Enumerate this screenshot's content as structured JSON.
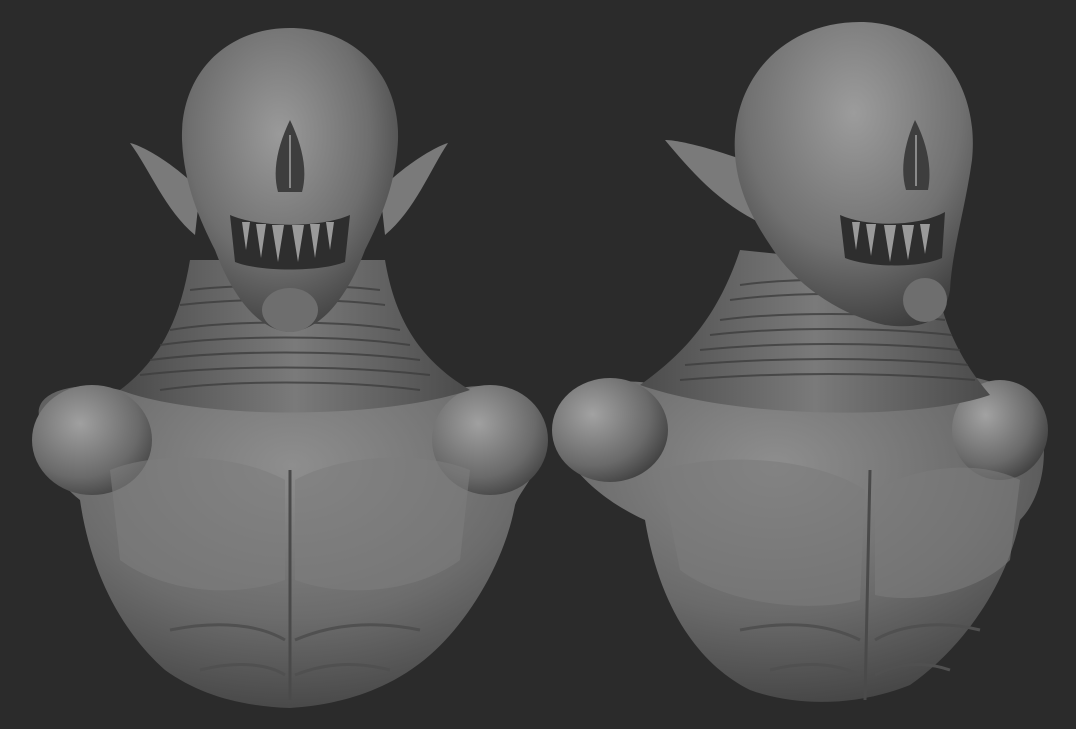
{
  "scene": {
    "background_color": "#2b2b2b",
    "material_color": "#8a8a8a",
    "views": [
      {
        "name": "front-view"
      },
      {
        "name": "three-quarter-view"
      }
    ]
  }
}
